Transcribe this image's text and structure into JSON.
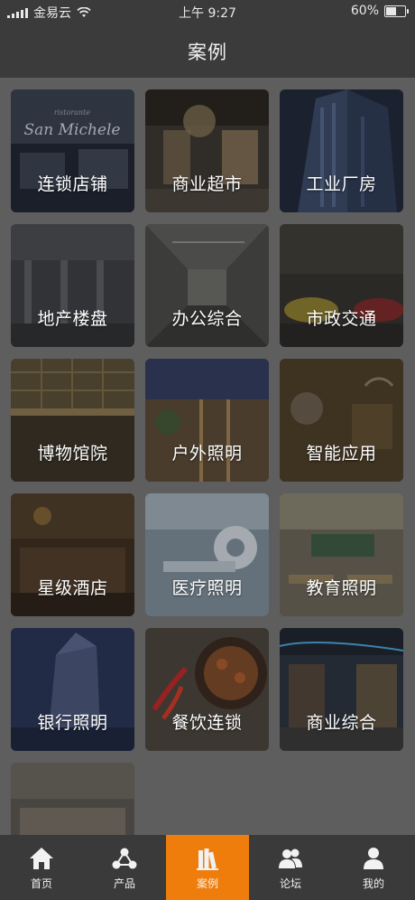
{
  "status_bar": {
    "carrier": "金易云",
    "time": "上午 9:27",
    "battery": "60%",
    "battery_level": 0.6
  },
  "header": {
    "title": "案例"
  },
  "categories": [
    {
      "label": "连锁店铺",
      "sign_text": "San Michele"
    },
    {
      "label": "商业超市"
    },
    {
      "label": "工业厂房"
    },
    {
      "label": "地产楼盘"
    },
    {
      "label": "办公综合"
    },
    {
      "label": "市政交通"
    },
    {
      "label": "博物馆院"
    },
    {
      "label": "户外照明"
    },
    {
      "label": "智能应用"
    },
    {
      "label": "星级酒店"
    },
    {
      "label": "医疗照明"
    },
    {
      "label": "教育照明"
    },
    {
      "label": "银行照明"
    },
    {
      "label": "餐饮连锁"
    },
    {
      "label": "商业综合"
    },
    {
      "label": ""
    }
  ],
  "tabs": [
    {
      "label": "首页",
      "icon": "home-icon"
    },
    {
      "label": "产品",
      "icon": "product-icon"
    },
    {
      "label": "案例",
      "icon": "case-icon",
      "active": true
    },
    {
      "label": "论坛",
      "icon": "forum-icon"
    },
    {
      "label": "我的",
      "icon": "user-icon"
    }
  ],
  "colors": {
    "bar_bg": "#3b3b3b",
    "page_bg": "#5e5e5e",
    "active_tab": "#ef7d0b"
  }
}
